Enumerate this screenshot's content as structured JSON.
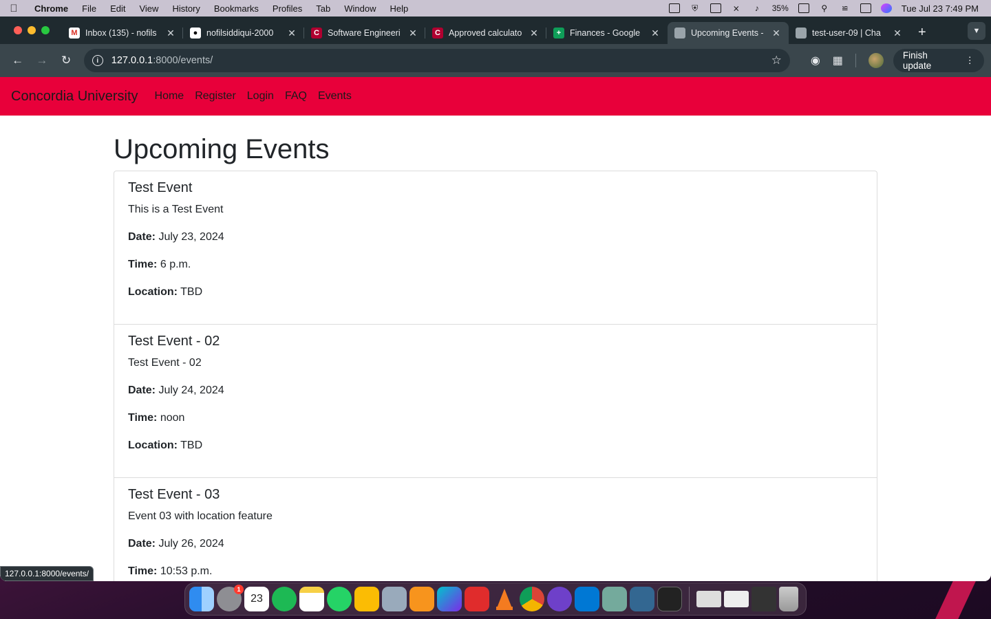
{
  "menubar": {
    "app_name": "Chrome",
    "menus": [
      "File",
      "Edit",
      "View",
      "History",
      "Bookmarks",
      "Profiles",
      "Tab",
      "Window",
      "Help"
    ],
    "battery": "35%",
    "clock": "Tue Jul 23  7:49 PM"
  },
  "browser": {
    "tabs": [
      {
        "title": "Inbox (135) - nofils",
        "favicon": "gmail-icon",
        "glyph": "M"
      },
      {
        "title": "nofilsiddiqui-2000",
        "favicon": "github-icon",
        "glyph": "●"
      },
      {
        "title": "Software Engineeri",
        "favicon": "concordia-icon",
        "glyph": "C"
      },
      {
        "title": "Approved calculato",
        "favicon": "concordia-icon",
        "glyph": "C"
      },
      {
        "title": "Finances - Google",
        "favicon": "sheets-icon",
        "glyph": "+"
      },
      {
        "title": "Upcoming Events -",
        "favicon": "globe-icon",
        "glyph": ""
      },
      {
        "title": "test-user-09 | Cha",
        "favicon": "globe-icon",
        "glyph": ""
      }
    ],
    "url_host": "127.0.0.1",
    "url_path": ":8000/events/",
    "finish_update_label": "Finish update",
    "status_url": "127.0.0.1:8000/events/"
  },
  "site": {
    "brand": "Concordia University",
    "nav": [
      "Home",
      "Register",
      "Login",
      "FAQ",
      "Events"
    ],
    "page_title": "Upcoming Events",
    "labels": {
      "date": "Date:",
      "time": "Time:",
      "location": "Location:"
    },
    "events": [
      {
        "title": "Test Event",
        "description": "This is a Test Event",
        "date": "July 23, 2024",
        "time": "6 p.m.",
        "location": "TBD"
      },
      {
        "title": "Test Event - 02",
        "description": "Test Event - 02",
        "date": "July 24, 2024",
        "time": "noon",
        "location": "TBD"
      },
      {
        "title": "Test Event - 03",
        "description": "Event 03 with location feature",
        "date": "July 26, 2024",
        "time": "10:53 p.m."
      }
    ]
  },
  "dock": {
    "calendar_day": "23",
    "settings_badge": "1"
  },
  "colors": {
    "site_nav": "#e8003a",
    "browser_frame": "#1f2a2f",
    "toolbar": "#3a464c"
  }
}
